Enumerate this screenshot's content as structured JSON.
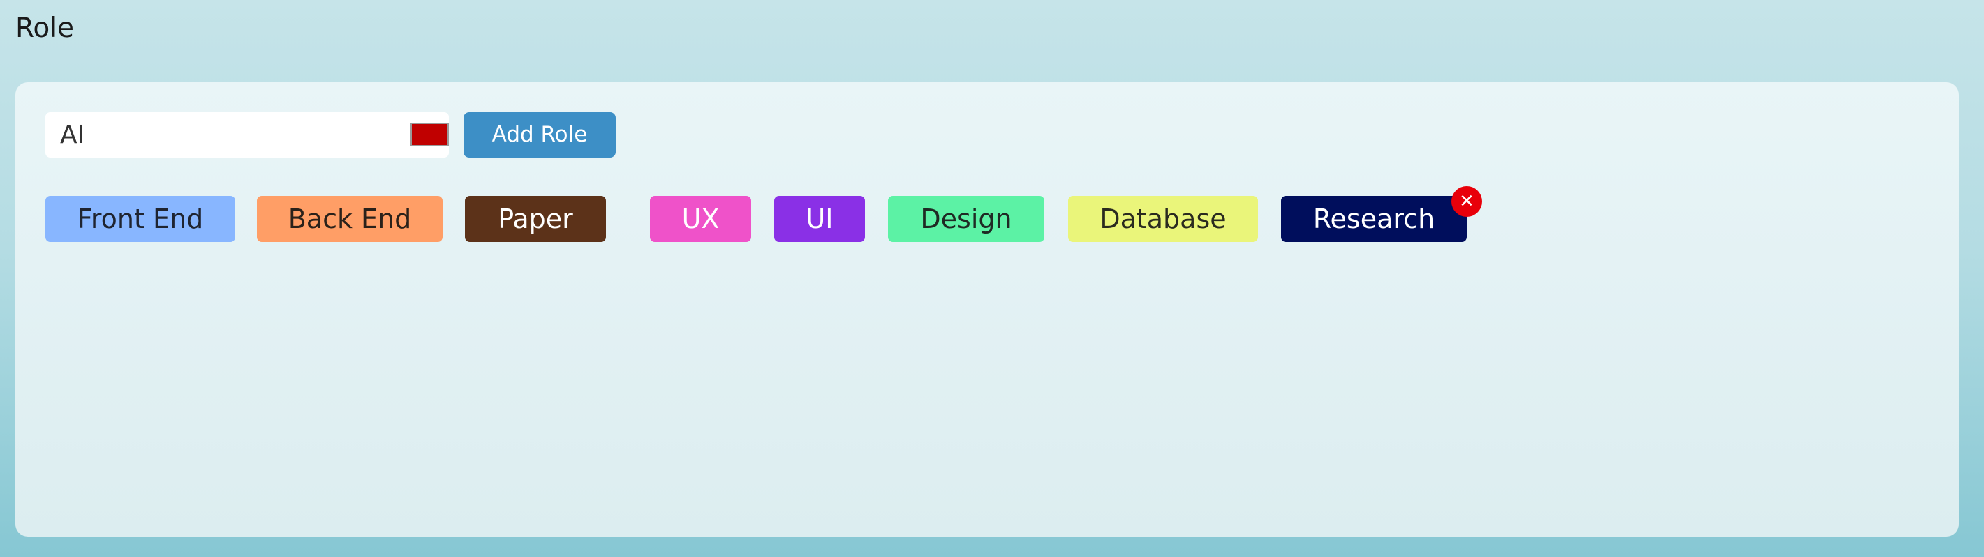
{
  "section": {
    "title": "Role"
  },
  "form": {
    "input_value": "AI",
    "color_value": "#c00000",
    "add_label": "Add Role"
  },
  "roles": [
    {
      "label": "Front End",
      "bg": "#88b6ff",
      "fg": "#1f2430"
    },
    {
      "label": "Back End",
      "bg": "#ff9e66",
      "fg": "#2a211a"
    },
    {
      "label": "Paper",
      "bg": "#5c3219",
      "fg": "#ffffff"
    },
    {
      "label": "UX",
      "bg": "#ef52c9",
      "fg": "#ffffff"
    },
    {
      "label": "UI",
      "bg": "#8a30e6",
      "fg": "#ffffff"
    },
    {
      "label": "Design",
      "bg": "#5cf2a5",
      "fg": "#1f2a24"
    },
    {
      "label": "Database",
      "bg": "#eaf57a",
      "fg": "#2a2a1f"
    },
    {
      "label": "Research",
      "bg": "#000e5c",
      "fg": "#ffffff",
      "removable": true
    }
  ],
  "icons": {
    "remove": "close-icon",
    "remove_glyph": "✕"
  }
}
